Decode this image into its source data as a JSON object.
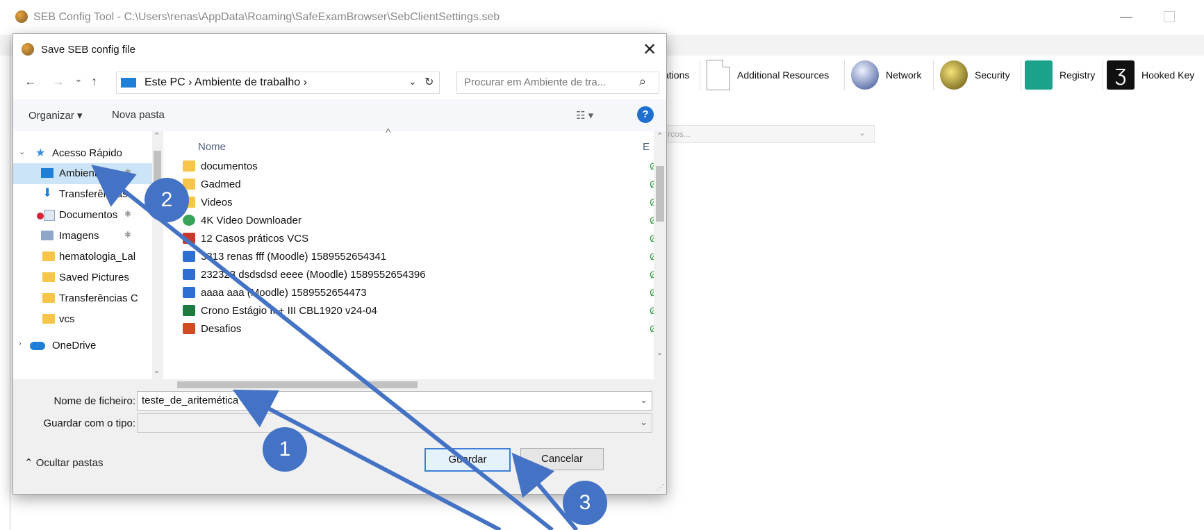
{
  "app": {
    "title": "SEB Config Tool - C:\\Users\\renas\\AppData\\Roaming\\SafeExamBrowser\\SebClientSettings.seb",
    "minimize": "—",
    "toolbar": [
      {
        "label": "ations",
        "icon": "document-icon"
      },
      {
        "label": "Additional Resources",
        "icon": "document-icon"
      },
      {
        "label": "Network",
        "icon": "globe-icon"
      },
      {
        "label": "Security",
        "icon": "keys-icon"
      },
      {
        "label": "Registry",
        "icon": "registry-icon"
      },
      {
        "label": "Hooked Key",
        "icon": "hook-icon"
      }
    ],
    "url_combo": "rcos..."
  },
  "dialog": {
    "title": "Save SEB config file",
    "close": "✕",
    "nav": {
      "back": "←",
      "forward": "→",
      "recent": "⌄",
      "up": "↑"
    },
    "address": {
      "crumbs": "Este PC  ›  Ambiente de trabalho  ›",
      "dropdown": "⌄",
      "refresh": "↻"
    },
    "search": {
      "placeholder": "Procurar em Ambiente de tra...",
      "icon": "⌕"
    },
    "commands": {
      "organize": "Organizar ▾",
      "new_folder": "Nova pasta",
      "view": "☷ ▾",
      "help": "?"
    },
    "navpane": [
      {
        "label": "Acesso Rápido",
        "icon": "star-icon",
        "indent": 0,
        "pinned": false
      },
      {
        "label": "Ambiente de",
        "icon": "desktop-icon",
        "indent": 1,
        "pinned": true,
        "selected": true
      },
      {
        "label": "Transferências",
        "icon": "download-icon",
        "indent": 1,
        "pinned": false
      },
      {
        "label": "Documentos",
        "icon": "documents-icon",
        "indent": 1,
        "pinned": true
      },
      {
        "label": "Imagens",
        "icon": "pictures-icon",
        "indent": 1,
        "pinned": true
      },
      {
        "label": "hematologia_Lal",
        "icon": "folder-icon",
        "indent": 1,
        "pinned": false
      },
      {
        "label": "Saved Pictures",
        "icon": "folder-icon",
        "indent": 1,
        "pinned": false
      },
      {
        "label": "Transferências C",
        "icon": "folder-icon",
        "indent": 1,
        "pinned": false
      },
      {
        "label": "vcs",
        "icon": "folder-icon",
        "indent": 1,
        "pinned": false
      },
      {
        "label": "OneDrive",
        "icon": "cloud-icon",
        "indent": 0,
        "pinned": false
      }
    ],
    "column_header": "Nome",
    "column_header_e": "E",
    "files": [
      {
        "name": "documentos",
        "type": "folder"
      },
      {
        "name": "Gadmed",
        "type": "folder"
      },
      {
        "name": "Videos",
        "type": "folder"
      },
      {
        "name": "4K Video Downloader",
        "type": "dl"
      },
      {
        "name": "12 Casos práticos VCS",
        "type": "pdf"
      },
      {
        "name": "3313 renas fff (Moodle) 1589552654341",
        "type": "xml"
      },
      {
        "name": "232323 dsdsdsd eeee (Moodle) 1589552654396",
        "type": "xml"
      },
      {
        "name": "aaaa aaa (Moodle) 1589552654473",
        "type": "xml"
      },
      {
        "name": "Crono Estágio II + III CBL1920 v24-04",
        "type": "xls"
      },
      {
        "name": "Desafios",
        "type": "ppt"
      }
    ],
    "status_glyph": "Ȼ",
    "filename_label": "Nome de ficheiro:",
    "filename_value": "teste_de_aritemética",
    "savetype_label": "Guardar com o tipo:",
    "savetype_value": "",
    "hide_folders": "⌃  Ocultar pastas",
    "save_button": "Guardar",
    "cancel_button": "Cancelar"
  },
  "callouts": [
    "1",
    "2",
    "3"
  ],
  "colors": {
    "callout": "#4472c4",
    "selection": "#cce4f7",
    "accent": "#1e6fd0"
  }
}
